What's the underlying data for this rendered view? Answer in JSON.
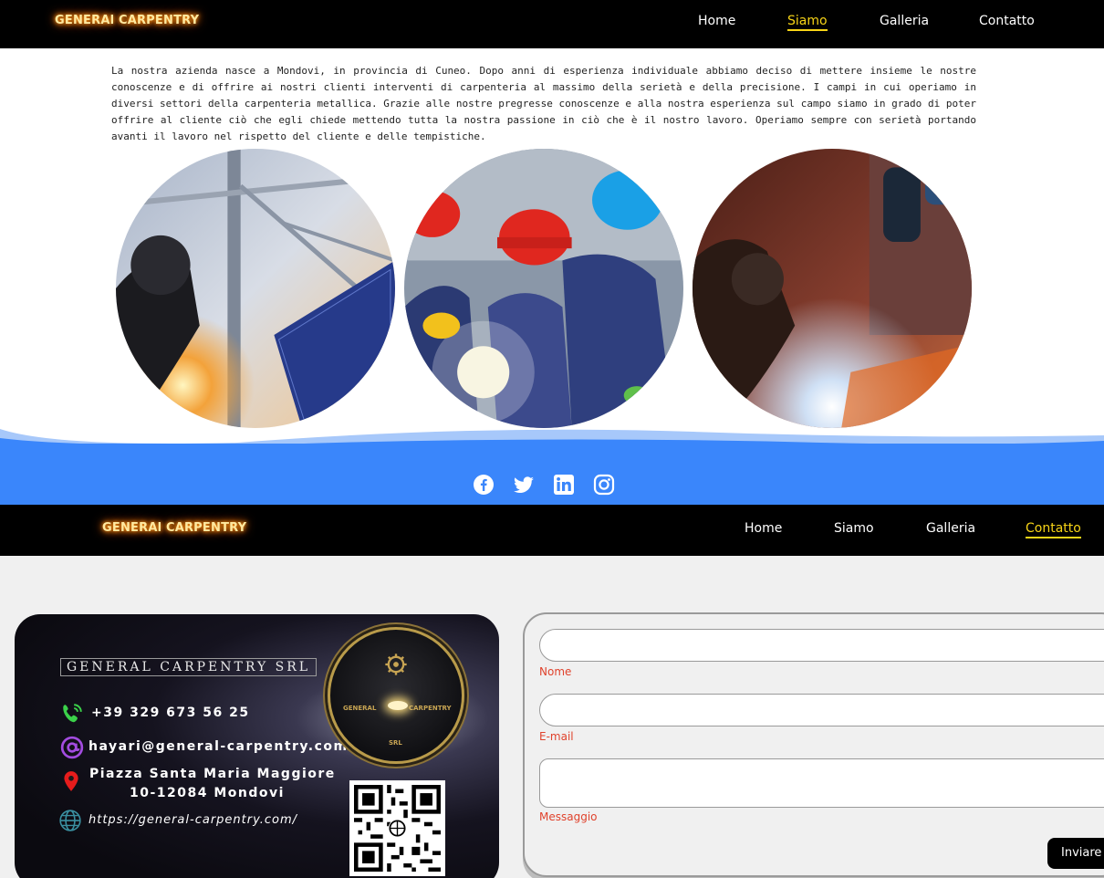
{
  "top_nav": {
    "logo": "GENERAl CARPENTRY",
    "items": [
      "Home",
      "Siamo",
      "Galleria",
      "Contatto"
    ],
    "active": "Siamo"
  },
  "about": {
    "text": "La nostra azienda nasce a Mondovi, in provincia di Cuneo. Dopo anni di esperienza individuale abbiamo deciso di mettere insieme le nostre conoscenze e di offrire ai nostri clienti interventi di carpenteria al massimo della serietà e della precisione. I campi in cui operiamo in diversi settori della carpenteria metallica. Grazie alle nostre pregresse conoscenze e alla nostra esperienza sul campo siamo in grado di poter offrire al cliente ciò che egli chiede mettendo tutta la nostra passione in ciò che è il nostro lavoro. Operiamo sempre con serietà portando avanti il lavoro nel rispetto del cliente e delle tempistiche."
  },
  "gallery": {
    "images": [
      "welder-solar-panel-image",
      "workers-helmets-image",
      "welding-sparks-image"
    ]
  },
  "social": {
    "icons": [
      "facebook-icon",
      "twitter-icon",
      "linkedin-icon",
      "instagram-icon"
    ],
    "band_color": "#3a86fb"
  },
  "second_nav": {
    "logo": "GENERAl CARPENTRY",
    "items": [
      "Home",
      "Siamo",
      "Galleria",
      "Contatto"
    ],
    "active": "Contatto"
  },
  "business_card": {
    "company": "GENERAL CARPENTRY SRL",
    "phone": "+39 329 673 56 25",
    "email": "hayari@general-carpentry.com",
    "address_line1": "Piazza Santa Maria Maggiore",
    "address_line2": "10-12084 Mondovi",
    "website": "https://general-carpentry.com/",
    "seal": {
      "left": "GENERAL",
      "right": "CARPENTRY",
      "bottom": "SRL"
    }
  },
  "form": {
    "name_label": "Nome",
    "email_label": "E-mail",
    "message_label": "Messaggio",
    "submit_label": "Inviare"
  },
  "colors": {
    "accent": "#f7d417",
    "label": "#e0422c"
  }
}
